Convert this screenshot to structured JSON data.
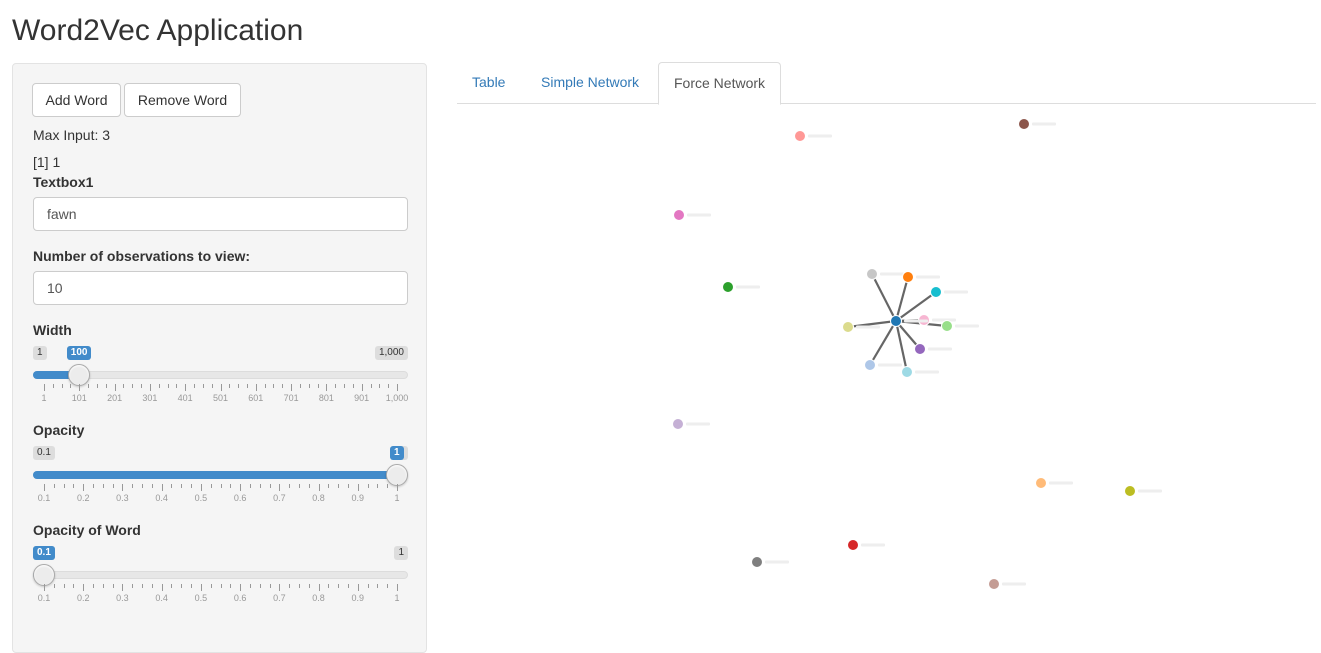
{
  "app": {
    "title": "Word2Vec Application"
  },
  "sidebar": {
    "add_word_label": "Add Word",
    "remove_word_label": "Remove Word",
    "max_input_text": "Max Input: 3",
    "index_text": "[1] 1",
    "textbox1": {
      "label": "Textbox1",
      "value": "fawn"
    },
    "num_obs": {
      "label": "Number of observations to view:",
      "value": "10"
    },
    "width_slider": {
      "label": "Width",
      "min_label": "1",
      "max_label": "1,000",
      "value_label": "100",
      "fraction": 0.1,
      "ticks": [
        "1",
        "101",
        "201",
        "301",
        "401",
        "501",
        "601",
        "701",
        "801",
        "901",
        "1,000"
      ]
    },
    "opacity_slider": {
      "label": "Opacity",
      "min_label": "0.1",
      "max_label": "1",
      "value_label": "1",
      "fraction": 1.0,
      "ticks": [
        "0.1",
        "0.2",
        "0.3",
        "0.4",
        "0.5",
        "0.6",
        "0.7",
        "0.8",
        "0.9",
        "1"
      ]
    },
    "opacity_word_slider": {
      "label": "Opacity of Word",
      "min_label": "0.1",
      "max_label": "1",
      "value_label": "0.1",
      "fraction": 0.0,
      "ticks": [
        "0.1",
        "0.2",
        "0.3",
        "0.4",
        "0.5",
        "0.6",
        "0.7",
        "0.8",
        "0.9",
        "1"
      ]
    }
  },
  "tabs": [
    {
      "label": "Table",
      "active": false
    },
    {
      "label": "Simple Network",
      "active": false
    },
    {
      "label": "Force Network",
      "active": true
    }
  ],
  "network": {
    "link_color": "#666666",
    "center_color": "#1f77b4",
    "connected_colors": [
      "#c7c7c7",
      "#ff7f0e",
      "#17becf",
      "#dbdb8d",
      "#f7b6d2",
      "#98df8a",
      "#9467bd",
      "#aec7e8",
      "#9edae5"
    ],
    "isolated_colors": [
      "#8c564b",
      "#ff9896",
      "#e377c2",
      "#2ca02c",
      "#c5b0d5",
      "#ffbb78",
      "#bcbd22",
      "#d62728",
      "#7f7f7f",
      "#c49c94"
    ]
  }
}
